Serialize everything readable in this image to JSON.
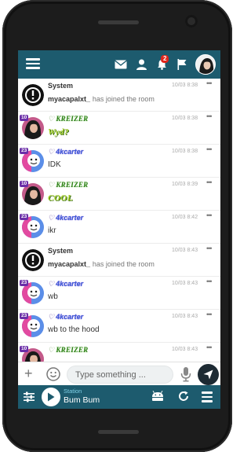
{
  "header": {
    "notification_count": "2",
    "icons": [
      "menu-icon",
      "mail-icon",
      "user-icon",
      "bell-icon",
      "flag-icon",
      "avatar"
    ]
  },
  "messages": [
    {
      "kind": "system",
      "user": "System",
      "actor": "myacapalxt_",
      "text": "has joined the room",
      "time": "10/03 8:38"
    },
    {
      "kind": "user",
      "user": "KREIZER",
      "level": "10",
      "text": "Wyd?",
      "style": "fancy",
      "time": "10/03 8:38",
      "avatar": "dark-hair"
    },
    {
      "kind": "user",
      "user": "4kcarter",
      "level": "23",
      "text": "IDK",
      "style": "plain",
      "time": "10/03 8:38",
      "avatar": "marshmello"
    },
    {
      "kind": "user",
      "user": "KREIZER",
      "level": "10",
      "text": "COOL",
      "style": "fancy",
      "time": "10/03 8:39",
      "avatar": "dark-hair"
    },
    {
      "kind": "user",
      "user": "4kcarter",
      "level": "23",
      "text": "ikr",
      "style": "plain",
      "time": "10/03 8:42",
      "avatar": "marshmello"
    },
    {
      "kind": "system",
      "user": "System",
      "actor": "myacapalxt_",
      "text": "has joined the room",
      "time": "10/03 8:43"
    },
    {
      "kind": "user",
      "user": "4kcarter",
      "level": "23",
      "text": "wb",
      "style": "plain",
      "time": "10/03 8:43",
      "avatar": "marshmello"
    },
    {
      "kind": "user",
      "user": "4kcarter",
      "level": "23",
      "text": "wb to the hood",
      "style": "plain",
      "time": "10/03 8:43",
      "avatar": "marshmello"
    },
    {
      "kind": "user",
      "user": "KREIZER",
      "level": "10",
      "text": "",
      "style": "fancy",
      "time": "10/03 8:43",
      "avatar": "dark-hair"
    }
  ],
  "composer": {
    "placeholder": "Type something ..."
  },
  "player": {
    "label": "Station",
    "station": "Bum Bum"
  },
  "colors": {
    "bar": "#1d5b6e",
    "send": "#1d2a33",
    "badge": "#e0251b"
  }
}
